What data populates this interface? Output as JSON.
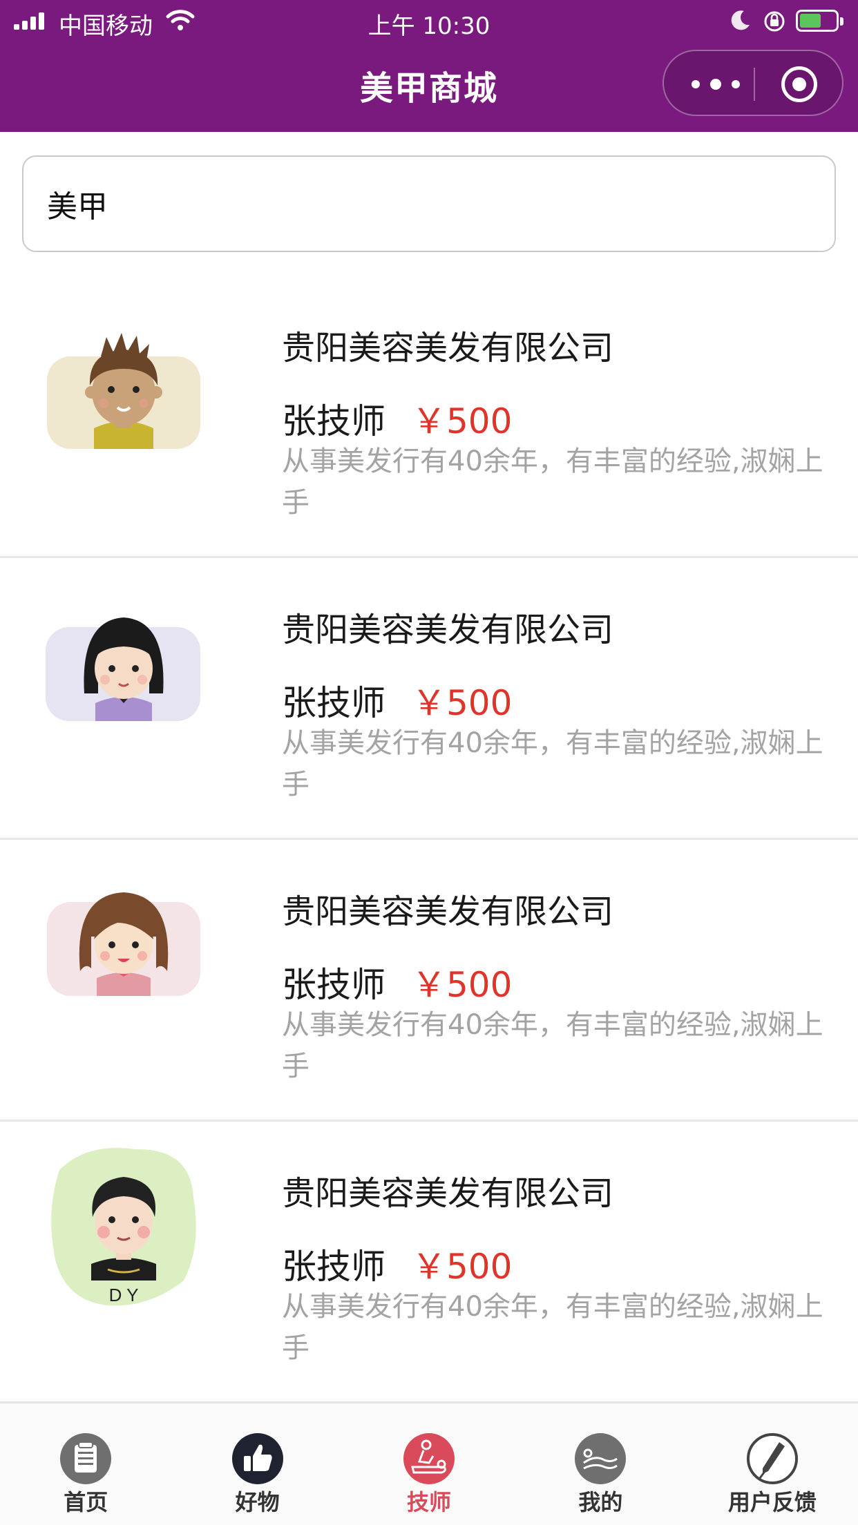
{
  "status_bar": {
    "carrier": "中国移动",
    "time": "上午 10:30"
  },
  "nav": {
    "title": "美甲商城",
    "capsule_more_icon": "more-dots-icon",
    "capsule_close_icon": "target-circle-icon",
    "bar_color": "#7a1a7e"
  },
  "search": {
    "value": "美甲"
  },
  "technicians": [
    {
      "company": "贵阳美容美发有限公司",
      "name": "张技师",
      "price": "￥500",
      "description": "从事美发行有40余年，有丰富的经验,淑娴上手",
      "avatar": "boy-cartoon-avatar"
    },
    {
      "company": "贵阳美容美发有限公司",
      "name": "张技师",
      "price": "￥500",
      "description": "从事美发行有40余年，有丰富的经验,淑娴上手",
      "avatar": "girl-black-hair-avatar"
    },
    {
      "company": "贵阳美容美发有限公司",
      "name": "张技师",
      "price": "￥500",
      "description": "从事美发行有40余年，有丰富的经验,淑娴上手",
      "avatar": "girl-brown-hair-avatar"
    },
    {
      "company": "贵阳美容美发有限公司",
      "name": "张技师",
      "price": "￥500",
      "description": "从事美发行有40余年，有丰富的经验,淑娴上手",
      "avatar": "man-dy-avatar",
      "avatar_caption": "D Y"
    }
  ],
  "tabbar": {
    "active_color": "#d94a5a",
    "price_color": "#e0342a",
    "tabs": [
      {
        "label": "首页",
        "icon": "clipboard-icon"
      },
      {
        "label": "好物",
        "icon": "thumbs-up-icon"
      },
      {
        "label": "技师",
        "icon": "massage-icon",
        "active": true
      },
      {
        "label": "我的",
        "icon": "relax-icon"
      },
      {
        "label": "用户反馈",
        "icon": "pen-icon"
      }
    ]
  }
}
